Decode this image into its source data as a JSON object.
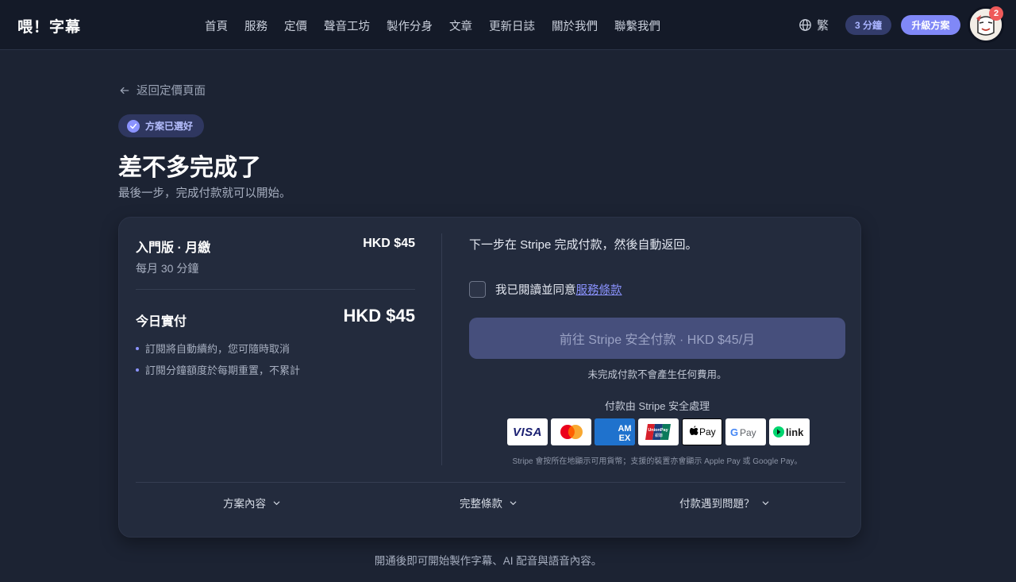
{
  "nav": {
    "brand": "喂！字幕",
    "links": [
      "首頁",
      "服務",
      "定價",
      "聲音工坊",
      "製作分身",
      "文章",
      "更新日誌",
      "關於我們",
      "聯繫我們"
    ],
    "language": "繁",
    "minutes_pill": "3 分鐘",
    "upgrade_label": "升級方案",
    "notification_count": "2"
  },
  "page": {
    "back_label": "返回定價頁面",
    "status_chip": "方案已選好",
    "title": "差不多完成了",
    "subtitle": "最後一步，完成付款就可以開始。"
  },
  "summary": {
    "plan_name": "入門版 · 月繳",
    "plan_price": "HKD $45",
    "plan_minutes": "每月 30 分鐘",
    "today_label": "今日實付",
    "today_amount": "HKD $45",
    "bullets": [
      "訂閱將自動續約，您可隨時取消",
      "訂閱分鐘額度於每期重置，不累計"
    ]
  },
  "checkout": {
    "next_step": "下一步在 Stripe 完成付款，然後自動返回。",
    "agree_prefix": "我已閱讀並同意",
    "terms_link": "服務條款",
    "pay_button": "前往 Stripe 安全付款 · HKD $45/月",
    "no_charge": "未完成付款不會產生任何費用。",
    "secured_by": "付款由 Stripe 安全處理",
    "payment_methods": [
      "VISA",
      "Mastercard",
      "AMEX",
      "UnionPay",
      "Apple Pay",
      "G Pay",
      "link"
    ],
    "logo_note": "Stripe 會按所在地顯示可用貨幣；支援的裝置亦會顯示 Apple Pay 或 Google Pay。"
  },
  "accordions": [
    "方案內容",
    "完整條款",
    "付款遇到問題？"
  ],
  "footer": "開通後即可開始製作字幕、AI 配音與語音內容。",
  "colors": {
    "background": "#1c2333",
    "card": "#232b3d",
    "accent": "#8088f7",
    "pay_button": "#464f7c"
  }
}
